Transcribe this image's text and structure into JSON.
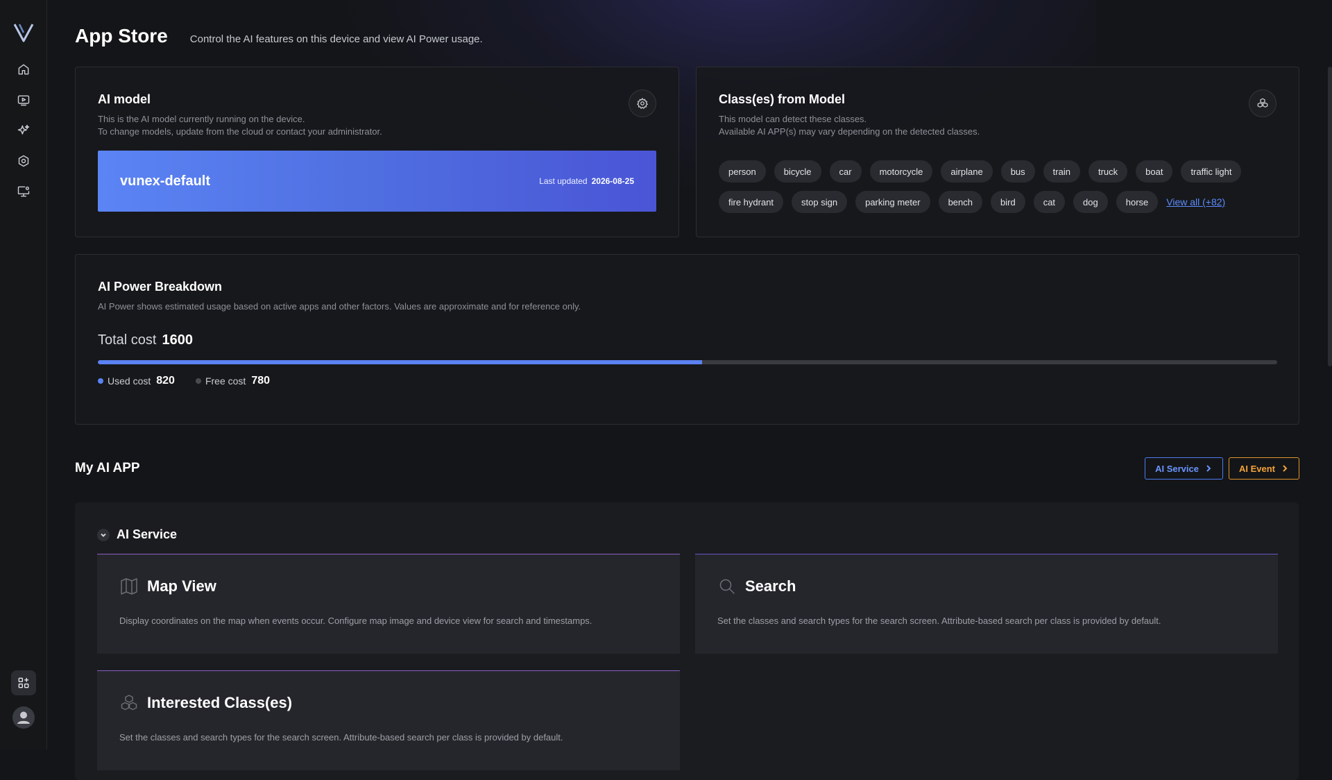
{
  "header": {
    "title": "App Store",
    "subtitle": "Control the AI features on this device and view AI Power usage."
  },
  "sidebar": {
    "items": [
      {
        "name": "home-icon"
      },
      {
        "name": "video-icon"
      },
      {
        "name": "sparkles-icon"
      },
      {
        "name": "settings-icon"
      },
      {
        "name": "monitor-settings-icon"
      }
    ],
    "bottom": [
      {
        "name": "apps-icon"
      },
      {
        "name": "user-avatar-icon"
      }
    ]
  },
  "ai_model": {
    "title": "AI model",
    "desc_line1": "This is the AI model currently running on the device.",
    "desc_line2": "To change models, update from the cloud or contact your administrator.",
    "model_name": "vunex-default",
    "last_updated_label": "Last updated",
    "last_updated_value": "2026-08-25"
  },
  "classes": {
    "title": "Class(es) from Model",
    "desc_line1": "This model can detect these classes.",
    "desc_line2": "Available AI APP(s) may vary depending on the detected classes.",
    "tags": [
      "person",
      "bicycle",
      "car",
      "motorcycle",
      "airplane",
      "bus",
      "train",
      "truck",
      "boat",
      "traffic light",
      "fire hydrant",
      "stop sign",
      "parking meter",
      "bench",
      "bird",
      "cat",
      "dog",
      "horse"
    ],
    "view_all": "View all (+82)"
  },
  "power": {
    "title": "AI Power Breakdown",
    "desc": "AI Power shows estimated usage based on active apps and other factors. Values are approximate and for reference only.",
    "total_label": "Total cost",
    "total_value": "1600",
    "used_label": "Used cost",
    "used_value": "820",
    "free_label": "Free cost",
    "free_value": "780",
    "used_fraction": 0.5125,
    "used_color": "#5b82f2",
    "free_color": "#4a4b50"
  },
  "my_app": {
    "title": "My AI APP",
    "btn_service": "AI Service",
    "btn_event": "AI Event",
    "group_title": "AI Service",
    "apps": [
      {
        "icon": "map-icon",
        "title": "Map View",
        "desc": "Display coordinates on the map when events occur. Configure map image and device view for search and timestamps."
      },
      {
        "icon": "search-icon",
        "title": "Search",
        "desc": "Set the classes and search types for the search screen. Attribute-based search per class is provided by default."
      },
      {
        "icon": "cubes-icon",
        "title": "Interested Class(es)",
        "desc": "Set the classes and search types for the search screen. Attribute-based search per class is provided by default."
      }
    ]
  },
  "colors": {
    "accent_blue": "#5b82f2",
    "accent_orange": "#f3a43a",
    "card_border_purple": "#8a5ec4"
  }
}
